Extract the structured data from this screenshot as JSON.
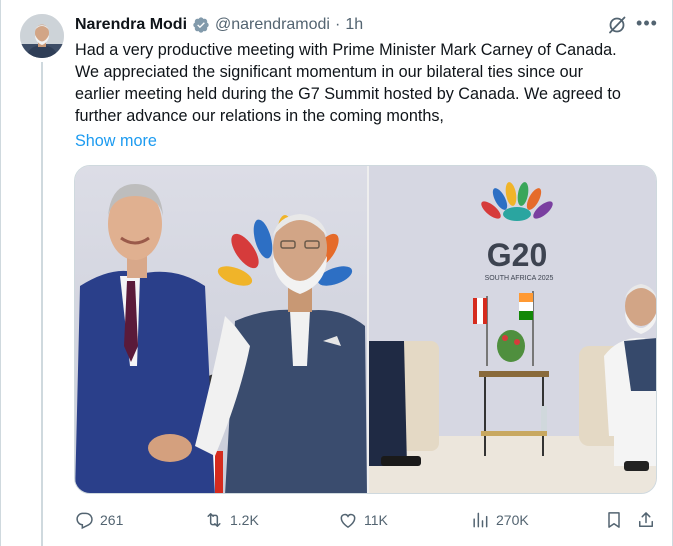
{
  "tweet": {
    "author": {
      "name": "Narendra Modi",
      "handle": "@narendramodi",
      "separator": "·",
      "time": "1h",
      "verified": true,
      "verified_color": "#829aab"
    },
    "text_lines": [
      "Had a very productive meeting with Prime Minister Mark Carney of Canada.",
      "We appreciated the significant momentum in our bilateral ties since our",
      "earlier meeting held during the G7 Summit hosted by Canada. We agreed to",
      "further advance our relations in the coming months,"
    ],
    "show_more": "Show more",
    "media": {
      "backdrop_logo": "G20",
      "backdrop_subtitle": "SOUTH AFRICA 2025"
    },
    "actions": {
      "replies": "261",
      "reposts": "1.2K",
      "likes": "11K",
      "views": "270K"
    },
    "icons": [
      "verified-badge-icon",
      "grok-icon",
      "more-icon",
      "reply-icon",
      "repost-icon",
      "like-icon",
      "views-icon",
      "bookmark-icon",
      "share-icon"
    ]
  },
  "colors": {
    "link": "#1d9bf0",
    "text": "#0f1419",
    "secondary": "#536471",
    "border": "#cfd9de"
  }
}
